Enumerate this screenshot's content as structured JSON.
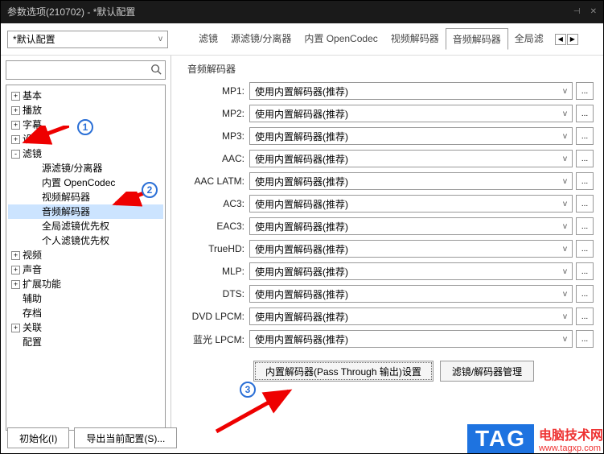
{
  "titlebar": {
    "title": "参数选项(210702) - *默认配置"
  },
  "config": {
    "selected": "*默认配置"
  },
  "tabs": [
    "滤镜",
    "源滤镜/分离器",
    "内置 OpenCodec",
    "视频解码器",
    "音频解码器",
    "全局滤"
  ],
  "active_tab_index": 4,
  "search": {
    "placeholder": ""
  },
  "tree": [
    {
      "level": 0,
      "toggle": "+",
      "label": "基本"
    },
    {
      "level": 0,
      "toggle": "+",
      "label": "播放"
    },
    {
      "level": 0,
      "toggle": "+",
      "label": "字幕"
    },
    {
      "level": 0,
      "toggle": "+",
      "label": "设备"
    },
    {
      "level": 0,
      "toggle": "-",
      "label": "滤镜"
    },
    {
      "level": 1,
      "toggle": "",
      "label": "源滤镜/分离器"
    },
    {
      "level": 1,
      "toggle": "",
      "label": "内置 OpenCodec"
    },
    {
      "level": 1,
      "toggle": "",
      "label": "视频解码器"
    },
    {
      "level": 1,
      "toggle": "",
      "label": "音频解码器",
      "selected": true
    },
    {
      "level": 1,
      "toggle": "",
      "label": "全局滤镜优先权"
    },
    {
      "level": 1,
      "toggle": "",
      "label": "个人滤镜优先权"
    },
    {
      "level": 0,
      "toggle": "+",
      "label": "视频"
    },
    {
      "level": 0,
      "toggle": "+",
      "label": "声音"
    },
    {
      "level": 0,
      "toggle": "+",
      "label": "扩展功能"
    },
    {
      "level": 0,
      "toggle": "",
      "label": "辅助"
    },
    {
      "level": 0,
      "toggle": "",
      "label": "存档"
    },
    {
      "level": 0,
      "toggle": "+",
      "label": "关联"
    },
    {
      "level": 0,
      "toggle": "",
      "label": "配置"
    }
  ],
  "group_title": "音频解码器",
  "decoders": [
    {
      "label": "MP1:",
      "value": "使用内置解码器(推荐)"
    },
    {
      "label": "MP2:",
      "value": "使用内置解码器(推荐)"
    },
    {
      "label": "MP3:",
      "value": "使用内置解码器(推荐)"
    },
    {
      "label": "AAC:",
      "value": "使用内置解码器(推荐)"
    },
    {
      "label": "AAC LATM:",
      "value": "使用内置解码器(推荐)"
    },
    {
      "label": "AC3:",
      "value": "使用内置解码器(推荐)"
    },
    {
      "label": "EAC3:",
      "value": "使用内置解码器(推荐)"
    },
    {
      "label": "TrueHD:",
      "value": "使用内置解码器(推荐)"
    },
    {
      "label": "MLP:",
      "value": "使用内置解码器(推荐)"
    },
    {
      "label": "DTS:",
      "value": "使用内置解码器(推荐)"
    },
    {
      "label": "DVD LPCM:",
      "value": "使用内置解码器(推荐)"
    },
    {
      "label": "蓝光 LPCM:",
      "value": "使用内置解码器(推荐)"
    }
  ],
  "buttons": {
    "passthrough": "内置解码器(Pass Through 输出)设置",
    "manage": "滤镜/解码器管理",
    "init": "初始化(I)",
    "export": "导出当前配置(S)..."
  },
  "badges": {
    "b1": "1",
    "b2": "2",
    "b3": "3"
  },
  "tag": {
    "logo": "TAG",
    "line1": "电脑技术网",
    "line2": "www.tagxp.com"
  }
}
